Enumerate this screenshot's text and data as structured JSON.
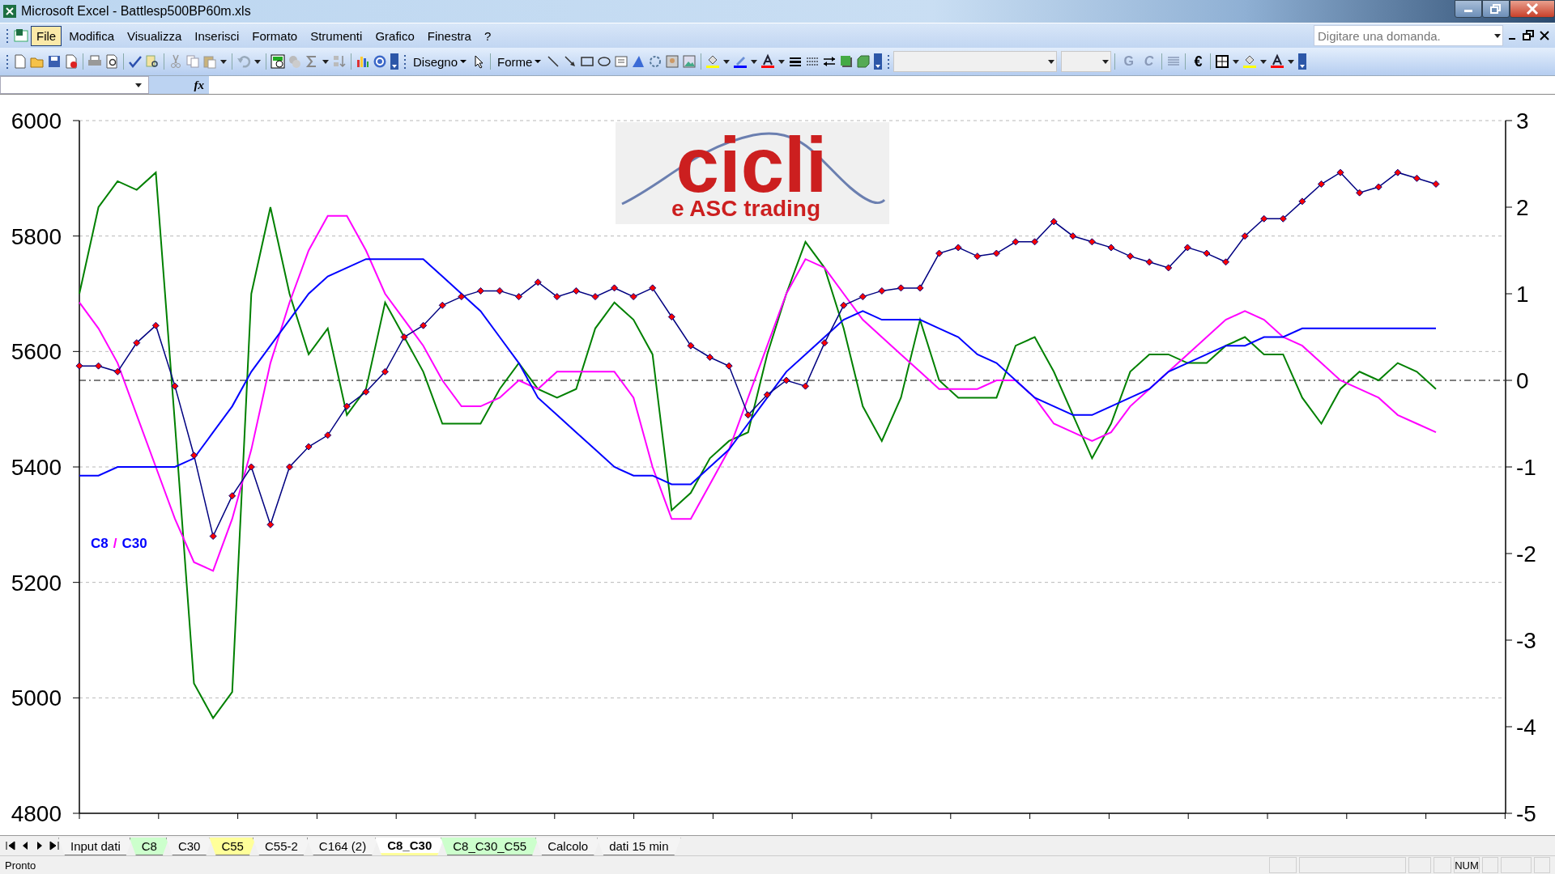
{
  "window": {
    "title": "Microsoft Excel - Battlesp500BP60m.xls"
  },
  "menu": [
    {
      "label": "File",
      "selected": true
    },
    {
      "label": "Modifica",
      "selected": false
    },
    {
      "label": "Visualizza",
      "selected": false
    },
    {
      "label": "Inserisci",
      "selected": false
    },
    {
      "label": "Formato",
      "selected": false
    },
    {
      "label": "Strumenti",
      "selected": false
    },
    {
      "label": "Grafico",
      "selected": false
    },
    {
      "label": "Finestra",
      "selected": false
    },
    {
      "label": "?",
      "selected": false
    }
  ],
  "help_search": {
    "placeholder": "Digitare una domanda."
  },
  "drawing_toolbar": {
    "menus": [
      "Disegno",
      "Forme"
    ]
  },
  "format_toolbar": {
    "bold": "G",
    "italic": "C",
    "currency": "€"
  },
  "formula_bar": {
    "function_label": "fx"
  },
  "chart": {
    "legend": [
      {
        "text": "C8",
        "color": "#0000ff"
      },
      {
        "text": "/",
        "color": "#ff00ff"
      },
      {
        "text": "C30",
        "color": "#0000ff"
      }
    ],
    "logo": {
      "title": "cicli",
      "tagline": "e ASC trading"
    },
    "chart_data": {
      "type": "line",
      "grid": true,
      "ref_lines": [
        {
          "axis": "y2",
          "value": 0
        }
      ],
      "ylim": [
        4800,
        6000
      ],
      "yticks": [
        4800,
        5000,
        5200,
        5400,
        5600,
        5800,
        6000
      ],
      "y2lim": [
        -5,
        3
      ],
      "y2ticks": [
        -5,
        -4,
        -3,
        -2,
        -1,
        0,
        1,
        2,
        3
      ],
      "series": [
        {
          "color": "#000080",
          "marker": "diamond",
          "values": [
            5575,
            5575,
            5565,
            5615,
            5645,
            5540,
            5420,
            5280,
            5350,
            5400,
            5300,
            5400,
            5435,
            5455,
            5505,
            5530,
            5565,
            5625,
            5645,
            5680,
            5695,
            5705,
            5705,
            5695,
            5720,
            5695,
            5705,
            5695,
            5710,
            5695,
            5710,
            5660,
            5610,
            5590,
            5575,
            5490,
            5525,
            5550,
            5540,
            5615,
            5680,
            5695,
            5705,
            5710,
            5710,
            5770,
            5780,
            5765,
            5770,
            5790,
            5790,
            5825,
            5800,
            5790,
            5780,
            5765,
            5755,
            5745,
            5780,
            5770,
            5755,
            5800,
            5830,
            5830,
            5860,
            5890,
            5910,
            5875,
            5885,
            5910,
            5900,
            5890
          ]
        },
        {
          "color": "#0000ff",
          "axis": "y2",
          "values": [
            -1.1,
            -1.1,
            -1,
            -1,
            -1,
            -1,
            -0.9,
            -0.6,
            -0.3,
            0.1,
            0.4,
            0.7,
            1,
            1.2,
            1.3,
            1.4,
            1.4,
            1.4,
            1.4,
            1.2,
            1,
            0.8,
            0.5,
            0.2,
            -0.2,
            -0.4,
            -0.6,
            -0.8,
            -1,
            -1.1,
            -1.1,
            -1.2,
            -1.2,
            -1,
            -0.8,
            -0.5,
            -0.2,
            0.1,
            0.3,
            0.5,
            0.7,
            0.8,
            0.7,
            0.7,
            0.7,
            0.6,
            0.5,
            0.3,
            0.2,
            0,
            -0.2,
            -0.3,
            -0.4,
            -0.4,
            -0.3,
            -0.2,
            -0.1,
            0.1,
            0.2,
            0.3,
            0.4,
            0.4,
            0.5,
            0.5,
            0.6,
            0.6,
            0.6,
            0.6,
            0.6,
            0.6,
            0.6,
            0.6
          ]
        },
        {
          "color": "#ff00ff",
          "axis": "y2",
          "values": [
            0.9,
            0.6,
            0.2,
            -0.4,
            -1,
            -1.6,
            -2.1,
            -2.2,
            -1.6,
            -0.8,
            0.2,
            0.9,
            1.5,
            1.9,
            1.9,
            1.5,
            1,
            0.7,
            0.4,
            0,
            -0.3,
            -0.3,
            -0.2,
            0,
            -0.1,
            0.1,
            0.1,
            0.1,
            0.1,
            -0.2,
            -1,
            -1.6,
            -1.6,
            -1.2,
            -0.8,
            -0.2,
            0.4,
            1,
            1.4,
            1.3,
            1,
            0.7,
            0.5,
            0.3,
            0.1,
            -0.1,
            -0.1,
            -0.1,
            0,
            0,
            -0.2,
            -0.5,
            -0.6,
            -0.7,
            -0.6,
            -0.3,
            -0.1,
            0.1,
            0.3,
            0.5,
            0.7,
            0.8,
            0.7,
            0.5,
            0.4,
            0.2,
            0,
            -0.1,
            -0.2,
            -0.4,
            -0.5,
            -0.6
          ]
        },
        {
          "color": "#008000",
          "axis": "y2",
          "values": [
            1,
            2,
            2.3,
            2.2,
            2.4,
            -0.5,
            -3.5,
            -3.9,
            -3.6,
            1,
            2,
            1,
            0.3,
            0.6,
            -0.4,
            -0.1,
            0.9,
            0.5,
            0.1,
            -0.5,
            -0.5,
            -0.5,
            -0.1,
            0.2,
            -0.1,
            -0.2,
            -0.1,
            0.6,
            0.9,
            0.7,
            0.3,
            -1.5,
            -1.3,
            -0.9,
            -0.7,
            -0.6,
            0.3,
            1,
            1.6,
            1.3,
            0.6,
            -0.3,
            -0.7,
            -0.2,
            0.7,
            0,
            -0.2,
            -0.2,
            -0.2,
            0.4,
            0.5,
            0.1,
            -0.4,
            -0.9,
            -0.5,
            0.1,
            0.3,
            0.3,
            0.2,
            0.2,
            0.4,
            0.5,
            0.3,
            0.3,
            -0.2,
            -0.5,
            -0.1,
            0.1,
            0,
            0.2,
            0.1,
            -0.1
          ]
        }
      ]
    }
  },
  "sheet_tabs": [
    {
      "label": "Input dati",
      "selected": false
    },
    {
      "label": "C8",
      "selected": false,
      "color": "#ccffcc"
    },
    {
      "label": "C30",
      "selected": false
    },
    {
      "label": "C55",
      "selected": false,
      "color": "#ffff99"
    },
    {
      "label": "C55-2",
      "selected": false
    },
    {
      "label": "C164 (2)",
      "selected": false
    },
    {
      "label": "C8_C30",
      "selected": true
    },
    {
      "label": "C8_C30_C55",
      "selected": false,
      "color": "#ccffcc"
    },
    {
      "label": "Calcolo",
      "selected": false
    },
    {
      "label": "dati 15 min",
      "selected": false
    }
  ],
  "status_bar": {
    "text": "Pronto",
    "indicators": [
      "NUM"
    ]
  }
}
